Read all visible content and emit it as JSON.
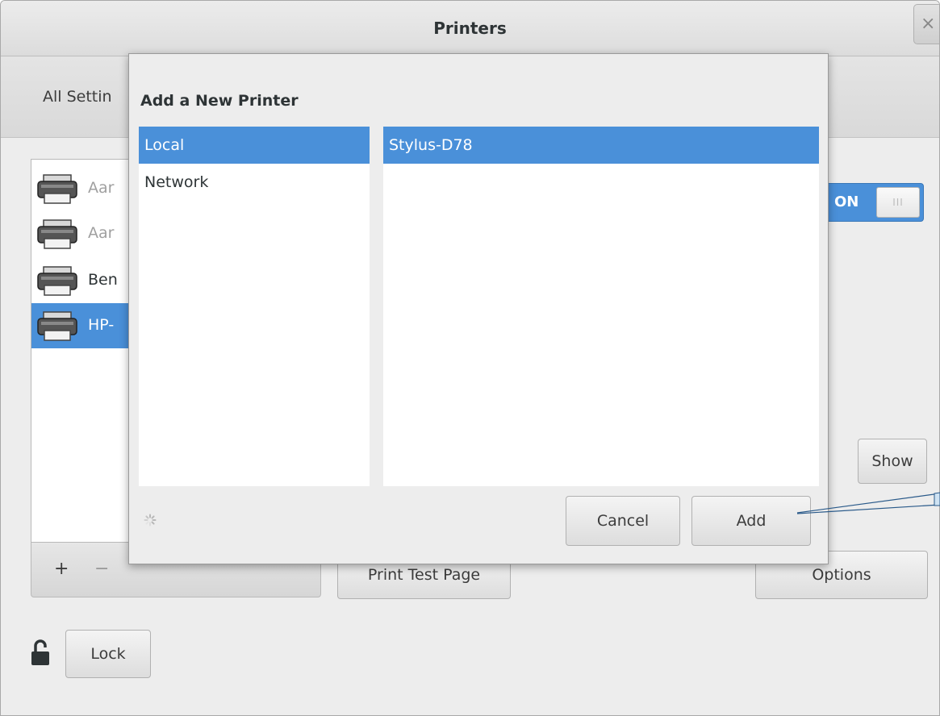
{
  "window": {
    "title": "Printers",
    "close_glyph": "×",
    "breadcrumb": "All Settin"
  },
  "printers": [
    {
      "name": "Aar",
      "dim": true
    },
    {
      "name": "Aar",
      "dim": true
    },
    {
      "name": "Ben",
      "dim": false
    },
    {
      "name": "HP-",
      "dim": false,
      "selected": true
    }
  ],
  "list_toolbar": {
    "add_glyph": "+",
    "remove_glyph": "−"
  },
  "printer_toggle": {
    "label": "ON",
    "knob": "III"
  },
  "buttons": {
    "show": "Show",
    "print_test_page": "Print Test Page",
    "options": "Options",
    "lock": "Lock"
  },
  "dialog": {
    "title": "Add a New Printer",
    "categories": [
      {
        "label": "Local",
        "selected": true
      },
      {
        "label": "Network",
        "selected": false
      }
    ],
    "devices": [
      {
        "label": "Stylus-D78",
        "selected": true
      }
    ],
    "cancel": "Cancel",
    "add": "Add"
  },
  "colors": {
    "selection": "#4a90d9",
    "window_bg": "#ededed",
    "callout": "#2a5a8a"
  },
  "icons": [
    "printer-icon",
    "lock-open-icon",
    "spinner-icon",
    "close-icon"
  ]
}
